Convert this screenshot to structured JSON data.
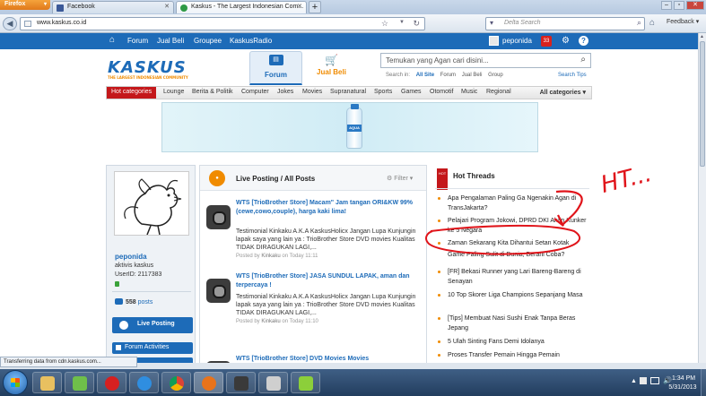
{
  "browser": {
    "app_button": "Firefox",
    "tabs": [
      {
        "label": "Facebook",
        "icon_color": "#3b5998"
      },
      {
        "label": "Kaskus - The Largest Indonesian Com...",
        "icon_color": "#2f9a45"
      }
    ],
    "new_tab_symbol": "+",
    "url": "www.kaskus.co.id",
    "search_placeholder": "Delta Search",
    "feedback_label": "Feedback",
    "status_text": "Transferring data from cdn.kaskus.com..."
  },
  "kaskus": {
    "topnav": {
      "items": [
        "Forum",
        "Jual Beli",
        "Groupee",
        "KaskusRadio"
      ],
      "username": "peponida",
      "notification_count": "33"
    },
    "header": {
      "logo_text": "KASKUS",
      "logo_tagline": "THE LARGEST INDONESIAN COMMUNITY",
      "tab_forum": "Forum",
      "tab_jualbeli": "Jual Beli",
      "search_placeholder": "Temukan yang Agan cari disini...",
      "search_in_label": "Search in:",
      "search_options": [
        "All Site",
        "Forum",
        "Jual Beli",
        "Group"
      ],
      "search_tips": "Search Tips"
    },
    "categories": {
      "hot_label": "Hot categories",
      "items": [
        "Lounge",
        "Berita & Politik",
        "Computer",
        "Jokes",
        "Movies",
        "Supranatural",
        "Sports",
        "Games",
        "Otomotif",
        "Music",
        "Regional"
      ],
      "all_label": "All categories"
    },
    "banner": {
      "brand": "AQUA"
    },
    "profile": {
      "username": "peponida",
      "role": "aktivis kaskus",
      "user_id": "UserID: 2117383",
      "post_count": "558",
      "post_word": "posts",
      "live_posting_label": "Live Posting",
      "forum_activities_label": "Forum Activities"
    },
    "live_posting": {
      "title": "Live Posting / All Posts",
      "filter_label": "Filter",
      "posts": [
        {
          "title": "WTS [TrioBrother Store] Macam\" Jam tangan ORI&KW 99% (cewe,cowo,couple), harga kaki lima!",
          "body": "Testimonial Kinkaku A.K.A KaskusHolicx Jangan Lupa Kunjungin lapak saya yang lain ya : TrioBrother Store DVD movies Kualitas TIDAK DIRAGUKAN LAGI,...",
          "meta_prefix": "Posted by",
          "author": "Kinkaku",
          "meta_time": "on Today 11:11"
        },
        {
          "title": "WTS [TrioBrother Store] JASA SUNDUL LAPAK, aman dan terpercaya !",
          "body": "Testimonial Kinkaku A.K.A KaskusHolicx Jangan Lupa Kunjungin lapak saya yang lain ya : TrioBrother Store DVD movies Kualitas TIDAK DIRAGUKAN LAGI,...",
          "meta_prefix": "Posted by",
          "author": "Kinkaku",
          "meta_time": "on Today 11:10"
        },
        {
          "title": "WTS [TrioBrother Store] DVD Movies Movies",
          "body": "",
          "meta_prefix": "",
          "author": "",
          "meta_time": ""
        }
      ]
    },
    "hot_threads": {
      "flag": "HOT",
      "title": "Hot Threads",
      "items": [
        "Apa Pengalaman Paling Ga Ngenakin Agan di TransJakarta?",
        "Pelajari Program Jokowi, DPRD DKI Akan Kunker ke 5 Negara",
        "Zaman Sekarang Kita Dihantui Setan Kotak",
        "Game Paling Sulit di Dunia, Berani Coba?",
        "[FR] Bekasi Runner yang Lari Bareng-Bareng di Senayan",
        "10 Top Skorer Liga Champions Sepanjang Masa",
        "[Tips] Membuat Nasi Sushi Enak Tanpa Beras Jepang",
        "5 Ulah Sinting Fans Demi Idolanya",
        "Proses Transfer Pemain Hingga Pemain"
      ],
      "annotation_text": "HT..."
    }
  },
  "taskbar": {
    "time": "1:34 PM",
    "date": "5/31/2013",
    "apps": [
      {
        "name": "explorer",
        "color": "#e8c060"
      },
      {
        "name": "media",
        "color": "#6fbf4a"
      },
      {
        "name": "opera",
        "color": "#d62020"
      },
      {
        "name": "ie",
        "color": "#2f8ee0"
      },
      {
        "name": "chrome",
        "color": "#4caf50"
      },
      {
        "name": "firefox",
        "color": "#e8731b"
      },
      {
        "name": "player",
        "color": "#3a3a3a"
      },
      {
        "name": "tt",
        "color": "#cfcfcf"
      },
      {
        "name": "note",
        "color": "#8ccf3a"
      }
    ]
  },
  "colors": {
    "kaskus_blue": "#1d6bb8",
    "kaskus_orange": "#f08b00",
    "hot_red": "#c4181b",
    "annotation_red": "#e0141a"
  }
}
